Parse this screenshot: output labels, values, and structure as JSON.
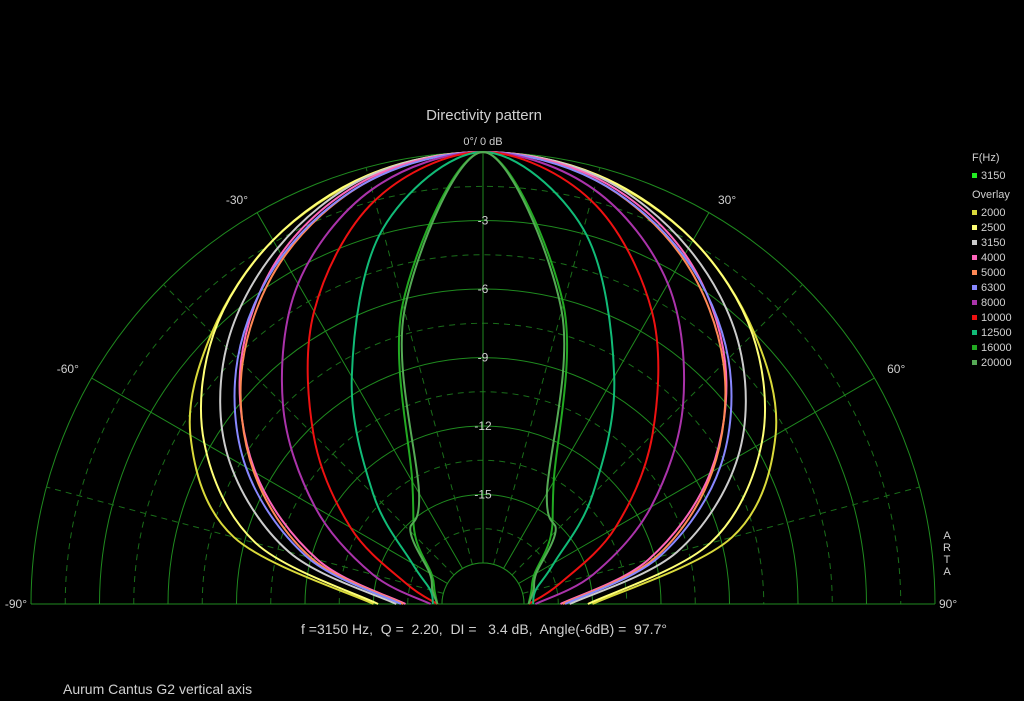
{
  "chart_data": {
    "type": "polar",
    "title": "Directivity pattern",
    "summary": "f =3150 Hz,  Q =  2.20,  DI =   3.4 dB,  Angle(-6dB) =  97.7°",
    "caption": "Aurum Cantus G2 vertical axis",
    "brand": "ARTA",
    "top_label": "0°/ 0 dB",
    "radial_tick_labels": [
      "-3",
      "-6",
      "-9",
      "-12",
      "-15"
    ],
    "angle_labels": [
      {
        "angle": -90,
        "text": "-90°"
      },
      {
        "angle": -60,
        "text": "-60°"
      },
      {
        "angle": -30,
        "text": "-30°"
      },
      {
        "angle": 30,
        "text": "30°"
      },
      {
        "angle": 60,
        "text": "60°"
      },
      {
        "angle": 90,
        "text": "90°"
      }
    ],
    "angle_range": [
      -90,
      90
    ],
    "radial_range_db": [
      -18,
      0
    ],
    "grid": true,
    "legend": {
      "placement": "right",
      "freq_header": "F(Hz)",
      "current": {
        "name": "3150",
        "color": "#22ee22"
      },
      "overlay_header": "Overlay"
    },
    "angles": [
      0,
      15,
      30,
      45,
      60,
      75,
      90
    ],
    "series": [
      {
        "name": "2000",
        "color": "#d9d93a",
        "values_db": [
          0,
          -0.4,
          -1.4,
          -3.0,
          -5.0,
          -8.5,
          -15.0
        ]
      },
      {
        "name": "2500",
        "color": "#ffff77",
        "values_db": [
          0,
          -0.35,
          -1.4,
          -3.1,
          -5.7,
          -9.5,
          -15.2
        ]
      },
      {
        "name": "3150",
        "color": "#cccccc",
        "values_db": [
          0,
          -0.4,
          -1.8,
          -3.9,
          -6.9,
          -11.0,
          -16.0
        ]
      },
      {
        "name": "4000",
        "color": "#ff66bb",
        "values_db": [
          0,
          -0.5,
          -2.1,
          -4.8,
          -8.3,
          -12.3,
          -16.4
        ]
      },
      {
        "name": "5000",
        "color": "#ff8855",
        "values_db": [
          0,
          -0.6,
          -2.3,
          -4.9,
          -8.2,
          -12.0,
          -16.3
        ]
      },
      {
        "name": "6300",
        "color": "#8888ff",
        "values_db": [
          0,
          -0.6,
          -2.2,
          -4.6,
          -7.8,
          -11.8,
          -16.2
        ]
      },
      {
        "name": "8000",
        "color": "#aa33aa",
        "values_db": [
          0,
          -1.0,
          -3.6,
          -7.4,
          -11.3,
          -14.8,
          -17.5
        ]
      },
      {
        "name": "10000",
        "color": "#ee1111",
        "values_db": [
          0,
          -1.5,
          -5.0,
          -9.3,
          -13.1,
          -16.3,
          -17.8
        ]
      },
      {
        "name": "12500",
        "color": "#11bb77",
        "values_db": [
          0,
          -2.8,
          -8.3,
          -13.0,
          -16.2,
          -17.4,
          -17.6
        ]
      },
      {
        "name": "16000",
        "color": "#22aa22",
        "values_db": [
          0,
          -6.2,
          -13.6,
          -15.6,
          -17.2,
          -17.6,
          -17.8
        ]
      },
      {
        "name": "20000",
        "color": "#55aa55",
        "values_db": [
          0,
          -6.5,
          -14.2,
          -15.3,
          -17.1,
          -17.5,
          -17.8
        ]
      }
    ]
  }
}
